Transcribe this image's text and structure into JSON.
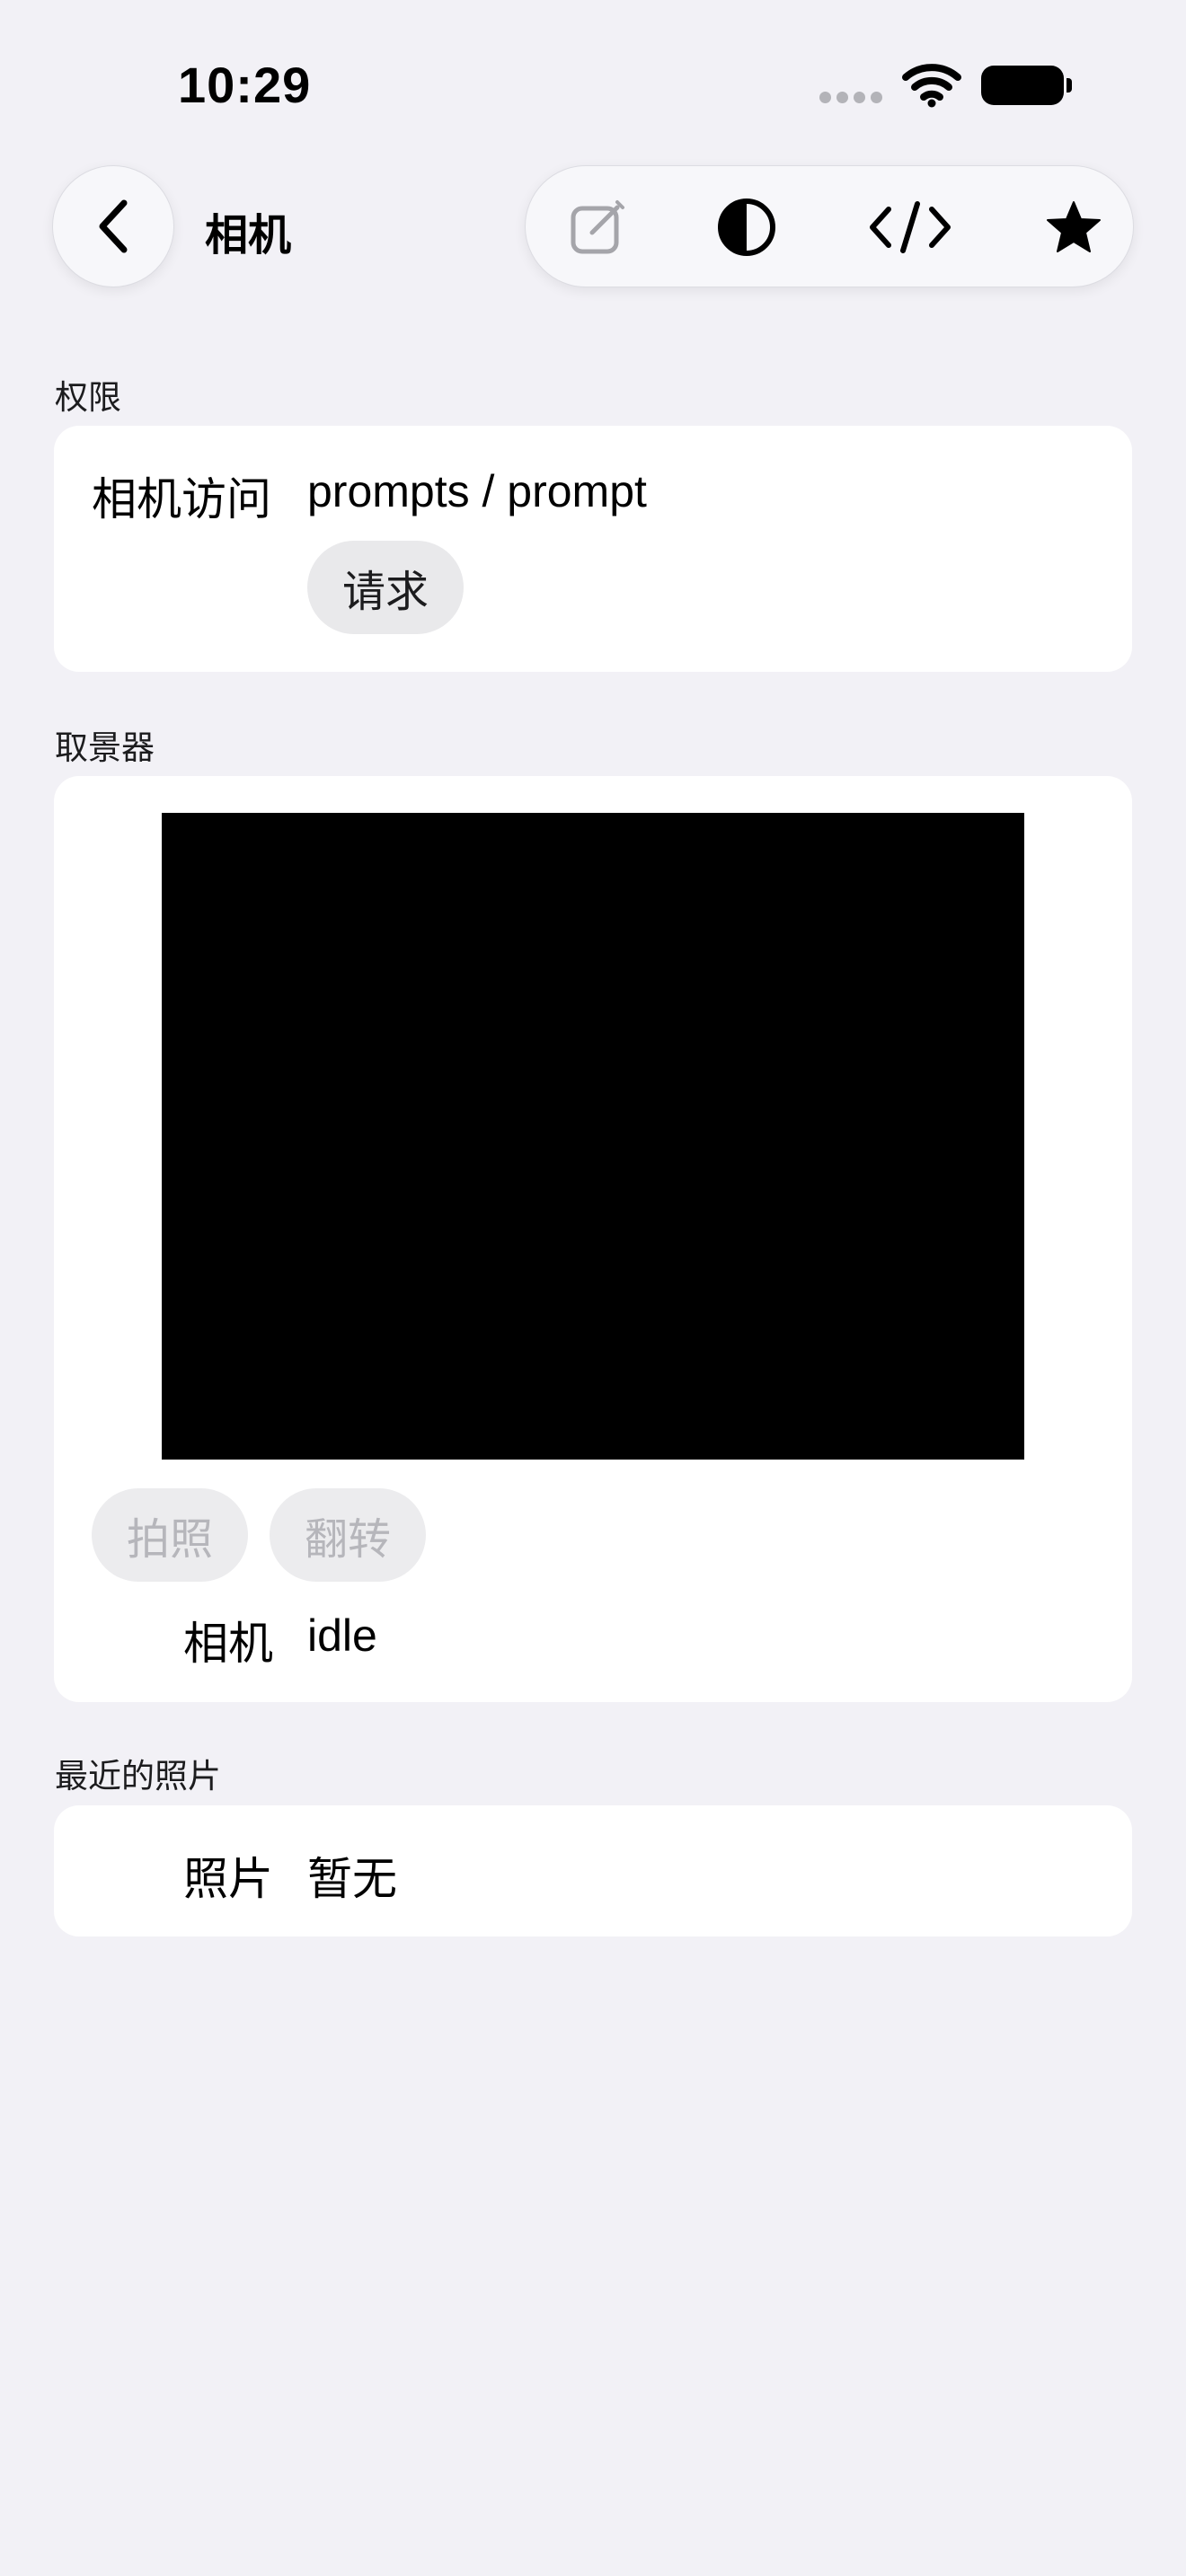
{
  "status_bar": {
    "time": "10:29"
  },
  "nav": {
    "title": "相机",
    "back_icon": "chevron-left-icon",
    "tools": [
      {
        "name": "compose-icon",
        "enabled": false
      },
      {
        "name": "appearance-icon",
        "enabled": true
      },
      {
        "name": "code-icon",
        "enabled": true
      },
      {
        "name": "star-icon",
        "enabled": true
      }
    ]
  },
  "permissions": {
    "header": "权限",
    "label": "相机访问",
    "value": "prompts / prompt",
    "request_button": "请求"
  },
  "viewfinder": {
    "header": "取景器",
    "capture_button": "拍照",
    "flip_button": "翻转",
    "status_label": "相机",
    "status_value": "idle"
  },
  "recent": {
    "header": "最近的照片",
    "label": "照片",
    "value": "暂无"
  },
  "colors": {
    "background": "#f2f1f6",
    "card": "#ffffff",
    "viewfinder": "#000000",
    "disabled_text": "#b6b6bb"
  }
}
